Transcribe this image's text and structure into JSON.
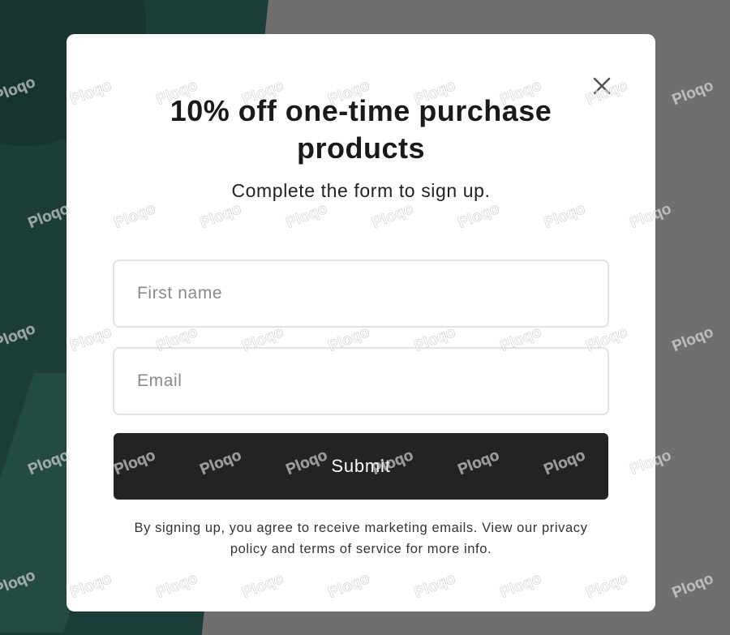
{
  "popup": {
    "title": "10% off one-time purchase products",
    "subtitle": "Complete the form to sign up.",
    "close_icon": "close-icon",
    "fields": {
      "first_name_placeholder": "First name",
      "first_name_value": "",
      "email_placeholder": "Email",
      "email_value": ""
    },
    "submit_label": "Submit",
    "disclaimer": "By signing up, you agree to receive marketing emails. View our privacy policy and terms of service for more info."
  },
  "watermark": {
    "text": "Ploqo"
  },
  "colors": {
    "backdrop": "#6f6f6f",
    "backdrop_accent": "#1c3d38",
    "modal_bg": "#ffffff",
    "button_bg": "#232323",
    "button_text": "#ffffff"
  }
}
